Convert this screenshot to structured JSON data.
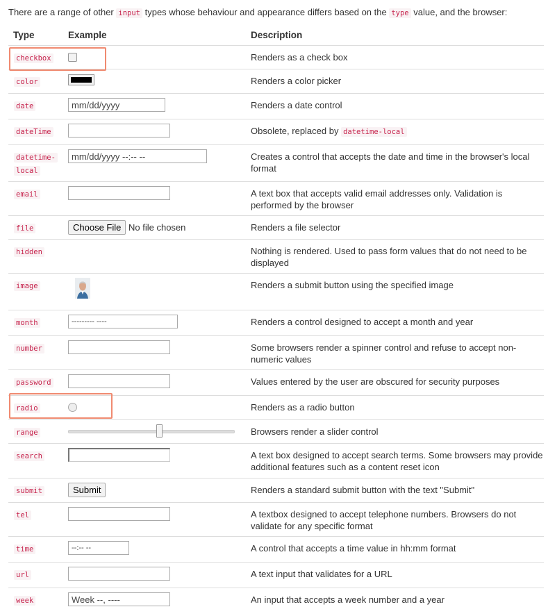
{
  "intro": {
    "before": "There are a range of other ",
    "code1": "input",
    "middle": " types whose behaviour and appearance differs based on the ",
    "code2": "type",
    "after": " value, and the browser:"
  },
  "headers": {
    "type": "Type",
    "example": "Example",
    "description": "Description"
  },
  "rows": [
    {
      "type": "checkbox",
      "description": "Renders as a check box"
    },
    {
      "type": "color",
      "description": "Renders a color picker"
    },
    {
      "type": "date",
      "value": "mm/dd/yyyy",
      "description": "Renders a date control"
    },
    {
      "type": "dateTime",
      "description_before": "Obsolete, replaced by ",
      "description_code": "datetime-local"
    },
    {
      "type_line1": "datetime-",
      "type_line2": "local",
      "value": "mm/dd/yyyy --:-- --",
      "description": "Creates a control that accepts the date and time in the browser's local format"
    },
    {
      "type": "email",
      "description": "A text box that accepts valid email addresses only. Validation is performed by the browser"
    },
    {
      "type": "file",
      "button": "Choose File",
      "status": "No file chosen",
      "description": "Renders a file selector"
    },
    {
      "type": "hidden",
      "description": "Nothing is rendered. Used to pass form values that do not need to be displayed"
    },
    {
      "type": "image",
      "description": "Renders a submit button using the specified image"
    },
    {
      "type": "month",
      "value": "--------- ----",
      "description": "Renders a control designed to accept a month and year"
    },
    {
      "type": "number",
      "description": "Some browsers render a spinner control and refuse to accept non-numeric values"
    },
    {
      "type": "password",
      "description": "Values entered by the user are obscured for security purposes"
    },
    {
      "type": "radio",
      "description": "Renders as a radio button"
    },
    {
      "type": "range",
      "value_fraction": 0.55,
      "description": "Browsers render a slider control"
    },
    {
      "type": "search",
      "description": "A text box designed to accept search terms. Some browsers may provide additional features such as a content reset icon"
    },
    {
      "type": "submit",
      "button": "Submit",
      "description": "Renders a standard submit button with the text \"Submit\""
    },
    {
      "type": "tel",
      "description": "A textbox designed to accept telephone numbers. Browsers do not validate for any specific format"
    },
    {
      "type": "time",
      "value": "--:-- --",
      "description": "A control that accepts a time value in hh:mm format"
    },
    {
      "type": "url",
      "description": "A text input that validates for a URL"
    },
    {
      "type": "week",
      "value": "Week --, ----",
      "description": "An input that accepts a week number and a year"
    }
  ],
  "highlight_color": "#f08a70",
  "code_color": "#c7254e"
}
